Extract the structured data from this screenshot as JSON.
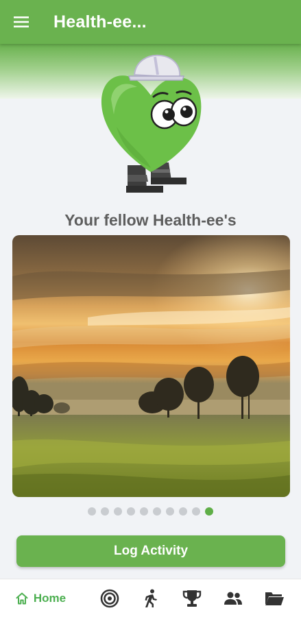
{
  "app_bar": {
    "title": "Health-ee...",
    "menu_icon": "menu-icon"
  },
  "mascot": {
    "icon": "heart-mascot-icon"
  },
  "feed": {
    "title": "Your fellow Health-ee's",
    "image": "sunrise-field-photo",
    "carousel": {
      "total": 10,
      "active_index": 9
    }
  },
  "actions": {
    "log_activity_label": "Log Activity"
  },
  "bottom_nav": {
    "items": [
      {
        "icon": "home-icon",
        "label": "Home",
        "active": true
      },
      {
        "icon": "target-icon",
        "label": ""
      },
      {
        "icon": "walking-icon",
        "label": ""
      },
      {
        "icon": "trophy-icon",
        "label": ""
      },
      {
        "icon": "people-icon",
        "label": ""
      },
      {
        "icon": "folder-icon",
        "label": ""
      }
    ],
    "active_color": "#4caf50"
  },
  "colors": {
    "primary": "#6ab24f",
    "dot_active": "#5fae47",
    "dot_inactive": "#c9ccd0",
    "background": "#f1f3f6"
  }
}
